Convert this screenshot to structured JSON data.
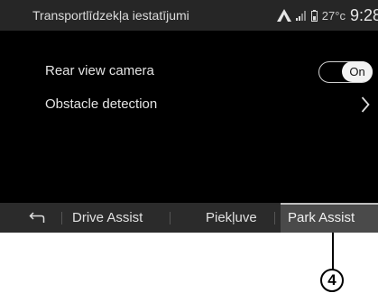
{
  "header": {
    "title": "Transportlīdzekļa iestatījumi",
    "temperature": "27°c",
    "time": "9:28"
  },
  "settings": [
    {
      "label": "Rear view camera",
      "control": "toggle",
      "value": "On"
    },
    {
      "label": "Obstacle detection",
      "control": "chevron"
    }
  ],
  "tabs": {
    "back_icon": "back-arrow-icon",
    "items": [
      "Drive Assist",
      "Piekļuve",
      "Park Assist"
    ],
    "active": "Park Assist"
  },
  "callout": {
    "number": "4"
  },
  "colors": {
    "screen_bg": "#000000",
    "bar_bg": "#262626",
    "active_tab": "#4a4a4a"
  }
}
